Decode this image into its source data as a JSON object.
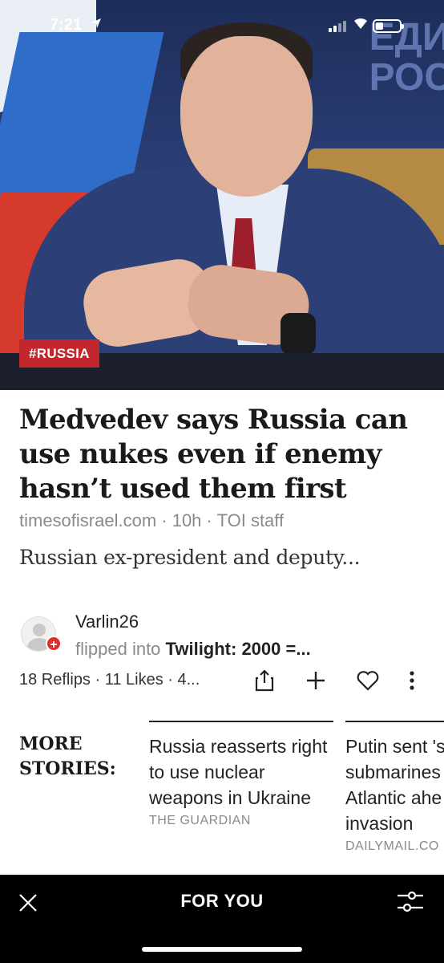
{
  "status_bar": {
    "time": "7:21"
  },
  "hero": {
    "tag": "#RUSSIA",
    "background_text": "ЕДИ\nРОС"
  },
  "article": {
    "headline": "Medvedev says Russia can use nukes even if enemy hasn’t used them first",
    "meta": "timesofisrael.com · 10h · TOI staff",
    "excerpt": "Russian ex-president and deputy..."
  },
  "flip": {
    "user": "Varlin26",
    "flipped_into": "flipped into",
    "magazine": "Twilight: 2000 =...",
    "stats": "18 Reflips · 11 Likes · 4..."
  },
  "more_stories": {
    "label_line1": "MORE",
    "label_line2": "STORIES:",
    "items": [
      {
        "title": "Russia reasserts right to use nuclear weapons in Ukraine",
        "source": "THE GUARDIAN"
      },
      {
        "title": "Putin sent 's submarines Atlantic ahe invasion",
        "source": "DAILYMAIL.CO"
      }
    ]
  },
  "bottom_bar": {
    "title": "FOR YOU"
  },
  "colors": {
    "tag_red": "#c1272d",
    "badge_red": "#e02b2b",
    "bar_black": "#000000"
  },
  "icons": [
    "location-arrow-icon",
    "signal-icon",
    "wifi-icon",
    "battery-icon",
    "share-icon",
    "plus-icon",
    "heart-icon",
    "more-vertical-icon",
    "close-icon",
    "filter-icon"
  ]
}
